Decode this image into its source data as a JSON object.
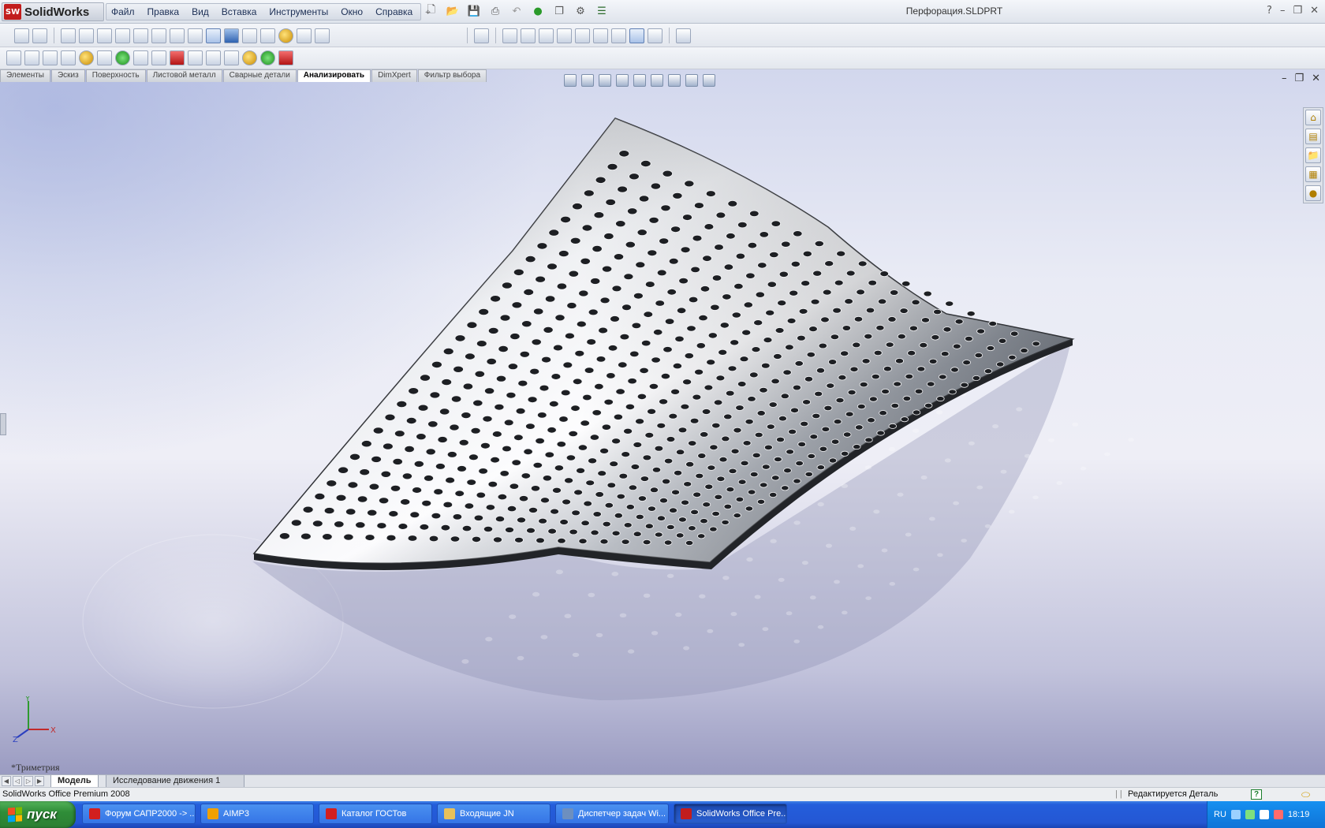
{
  "app": {
    "logo_text": "SolidWorks",
    "logo_mark": "SW",
    "document_title": "Перфорация.SLDPRT"
  },
  "menu": {
    "items": [
      "Файл",
      "Правка",
      "Вид",
      "Вставка",
      "Инструменты",
      "Окно",
      "Справка"
    ]
  },
  "command_tabs": {
    "items": [
      "Элементы",
      "Эскиз",
      "Поверхность",
      "Листовой металл",
      "Сварные детали",
      "Анализировать",
      "DimXpert",
      "Фильтр выбора"
    ],
    "active": "Анализировать"
  },
  "viewport": {
    "view_name": "*Триметрия",
    "triad": {
      "x": "X",
      "y": "Y",
      "z": "Z"
    }
  },
  "bottom_tabs": {
    "items": [
      "Модель",
      "Исследование движения 1"
    ],
    "active": "Модель"
  },
  "status": {
    "left": "SolidWorks Office Premium 2008",
    "right": "Редактируется Деталь",
    "help": "?"
  },
  "taskbar": {
    "start_label": "пуск",
    "tasks": [
      {
        "label": "Форум САПР2000 -> ...",
        "icon": "opera-icon",
        "color": "#d21f1f"
      },
      {
        "label": "AIMP3",
        "icon": "aimp-icon",
        "color": "#f0a000"
      },
      {
        "label": "Каталог ГОСТов",
        "icon": "gost-icon",
        "color": "#d21f1f"
      },
      {
        "label": "Входящие JN",
        "icon": "folder-icon",
        "color": "#e8c15a"
      },
      {
        "label": "Диспетчер задач Wi...",
        "icon": "taskmgr-icon",
        "color": "#6d8fbf"
      },
      {
        "label": "SolidWorks Office Pre...",
        "icon": "solidworks-icon",
        "color": "#c21d1d"
      }
    ],
    "active_task": "SolidWorks Office Pre...",
    "tray": {
      "lang": "RU",
      "time": "18:19"
    }
  },
  "colors": {
    "taskbar": "#245edb",
    "start_button": "#2f8d38",
    "solidworks_red": "#c21d1d"
  }
}
